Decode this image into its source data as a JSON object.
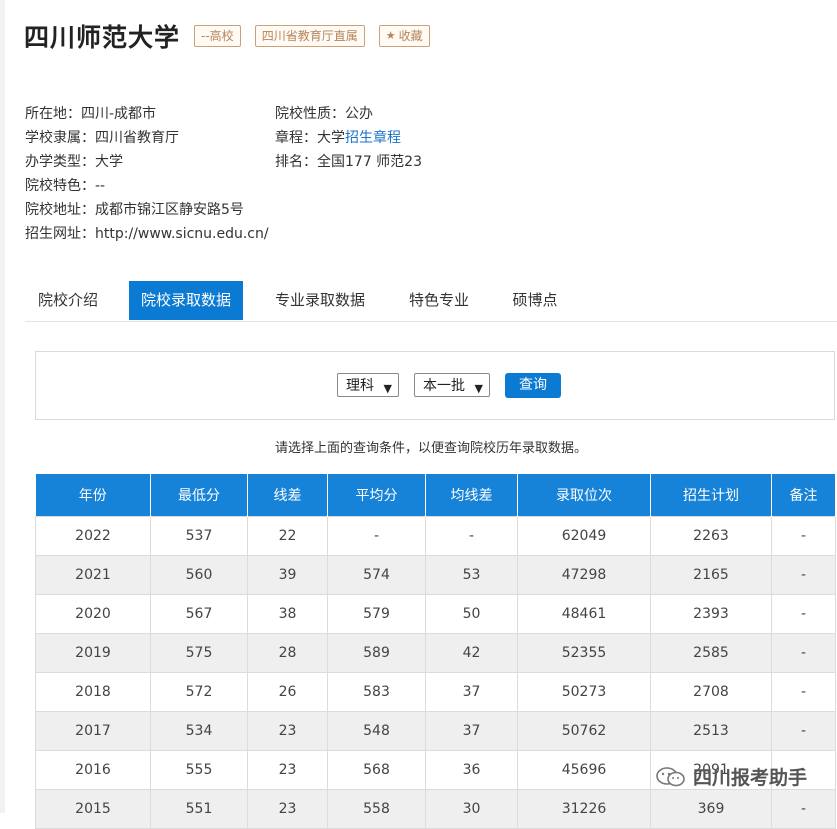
{
  "header": {
    "title": "四川师范大学",
    "tags": [
      "--高校",
      "四川省教育厅直属"
    ],
    "favorite": "收藏"
  },
  "info": {
    "col1": [
      {
        "label": "所在地：",
        "value": "四川-成都市"
      },
      {
        "label": "学校隶属：",
        "value": "四川省教育厅"
      },
      {
        "label": "办学类型：",
        "value": "大学"
      },
      {
        "label": "院校特色：",
        "value": "--"
      },
      {
        "label": "院校地址：",
        "value": "成都市锦江区静安路5号"
      },
      {
        "label": "招生网址：",
        "value": "http://www.sicnu.edu.cn/"
      }
    ],
    "col2": [
      {
        "label": "院校性质：",
        "value": "公办"
      },
      {
        "label": "章程：",
        "value": "大学",
        "link": "招生章程"
      },
      {
        "label": "排名：",
        "value": "全国177 师范23"
      }
    ]
  },
  "tabs": [
    "院校介绍",
    "院校录取数据",
    "专业录取数据",
    "特色专业",
    "硕博点"
  ],
  "active_tab": "院校录取数据",
  "query": {
    "subject": "理科",
    "batch": "本一批",
    "button": "查询"
  },
  "hint": "请选择上面的查询条件，以便查询院校历年录取数据。",
  "table": {
    "headers": [
      "年份",
      "最低分",
      "线差",
      "平均分",
      "均线差",
      "录取位次",
      "招生计划",
      "备注"
    ],
    "rows": [
      [
        "2022",
        "537",
        "22",
        "-",
        "-",
        "62049",
        "2263",
        "-"
      ],
      [
        "2021",
        "560",
        "39",
        "574",
        "53",
        "47298",
        "2165",
        "-"
      ],
      [
        "2020",
        "567",
        "38",
        "579",
        "50",
        "48461",
        "2393",
        "-"
      ],
      [
        "2019",
        "575",
        "28",
        "589",
        "42",
        "52355",
        "2585",
        "-"
      ],
      [
        "2018",
        "572",
        "26",
        "583",
        "37",
        "50273",
        "2708",
        "-"
      ],
      [
        "2017",
        "534",
        "23",
        "548",
        "37",
        "50762",
        "2513",
        "-"
      ],
      [
        "2016",
        "555",
        "23",
        "568",
        "36",
        "45696",
        "2091",
        "-"
      ],
      [
        "2015",
        "551",
        "23",
        "558",
        "30",
        "31226",
        "369",
        "-"
      ]
    ]
  },
  "watermark": "四川报考助手",
  "colors": {
    "primary": "#0b7ad3",
    "header_bg": "#1683d8",
    "tag": "#b5865a"
  }
}
